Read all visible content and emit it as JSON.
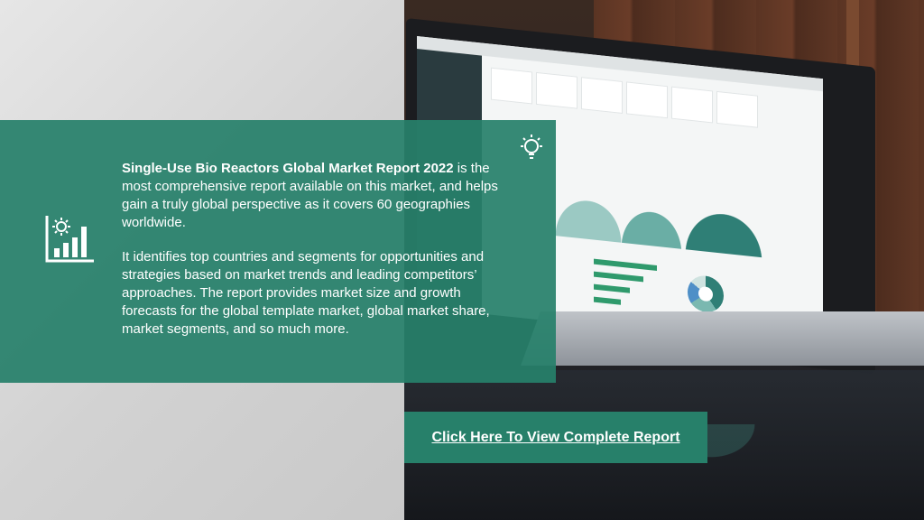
{
  "report": {
    "title": "Single-Use Bio Reactors Global Market Report 2022",
    "intro_rest": " is the most comprehensive report available on this market, and helps gain a truly global perspective as it covers 60 geographies worldwide.",
    "paragraph2": "It identifies top countries and segments for opportunities and strategies based on market trends and leading competitors’ approaches. The report provides market size and growth forecasts for the global template market, global market share, market segments, and so much more."
  },
  "cta": {
    "label": "Click Here To View Complete Report"
  },
  "icons": {
    "left": "bar-chart-icon",
    "right": "lightbulb-icon"
  },
  "colors": {
    "accent_green": "#27806a",
    "text": "#ffffff"
  }
}
